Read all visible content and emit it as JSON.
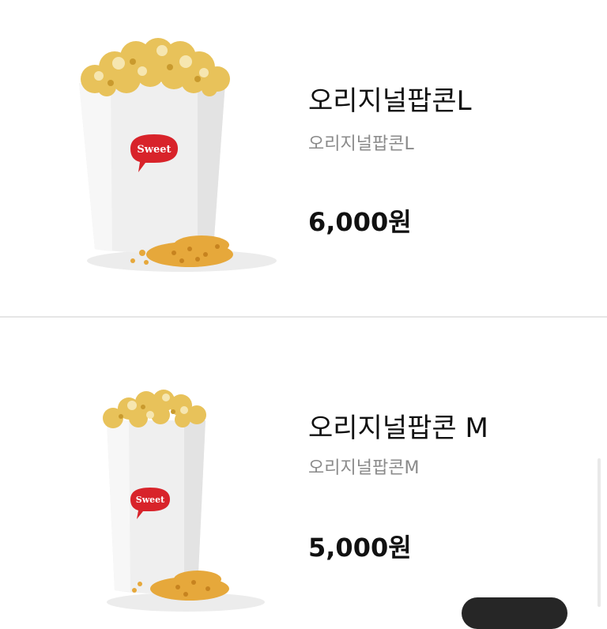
{
  "products": [
    {
      "name": "오리지널팝콘L",
      "description": "오리지널팝콘L",
      "price": "6,000원",
      "cup_logo": "Sweet",
      "icon": "popcorn-large-image"
    },
    {
      "name": "오리지널팝콘 M",
      "description": "오리지널팝콘M",
      "price": "5,000원",
      "cup_logo": "Sweet",
      "icon": "popcorn-medium-image"
    }
  ],
  "colors": {
    "background": "#ffffff",
    "title": "#111111",
    "subtitle": "#8a8a8a",
    "divider": "#e6e6e6",
    "logo_red": "#d8232a"
  }
}
